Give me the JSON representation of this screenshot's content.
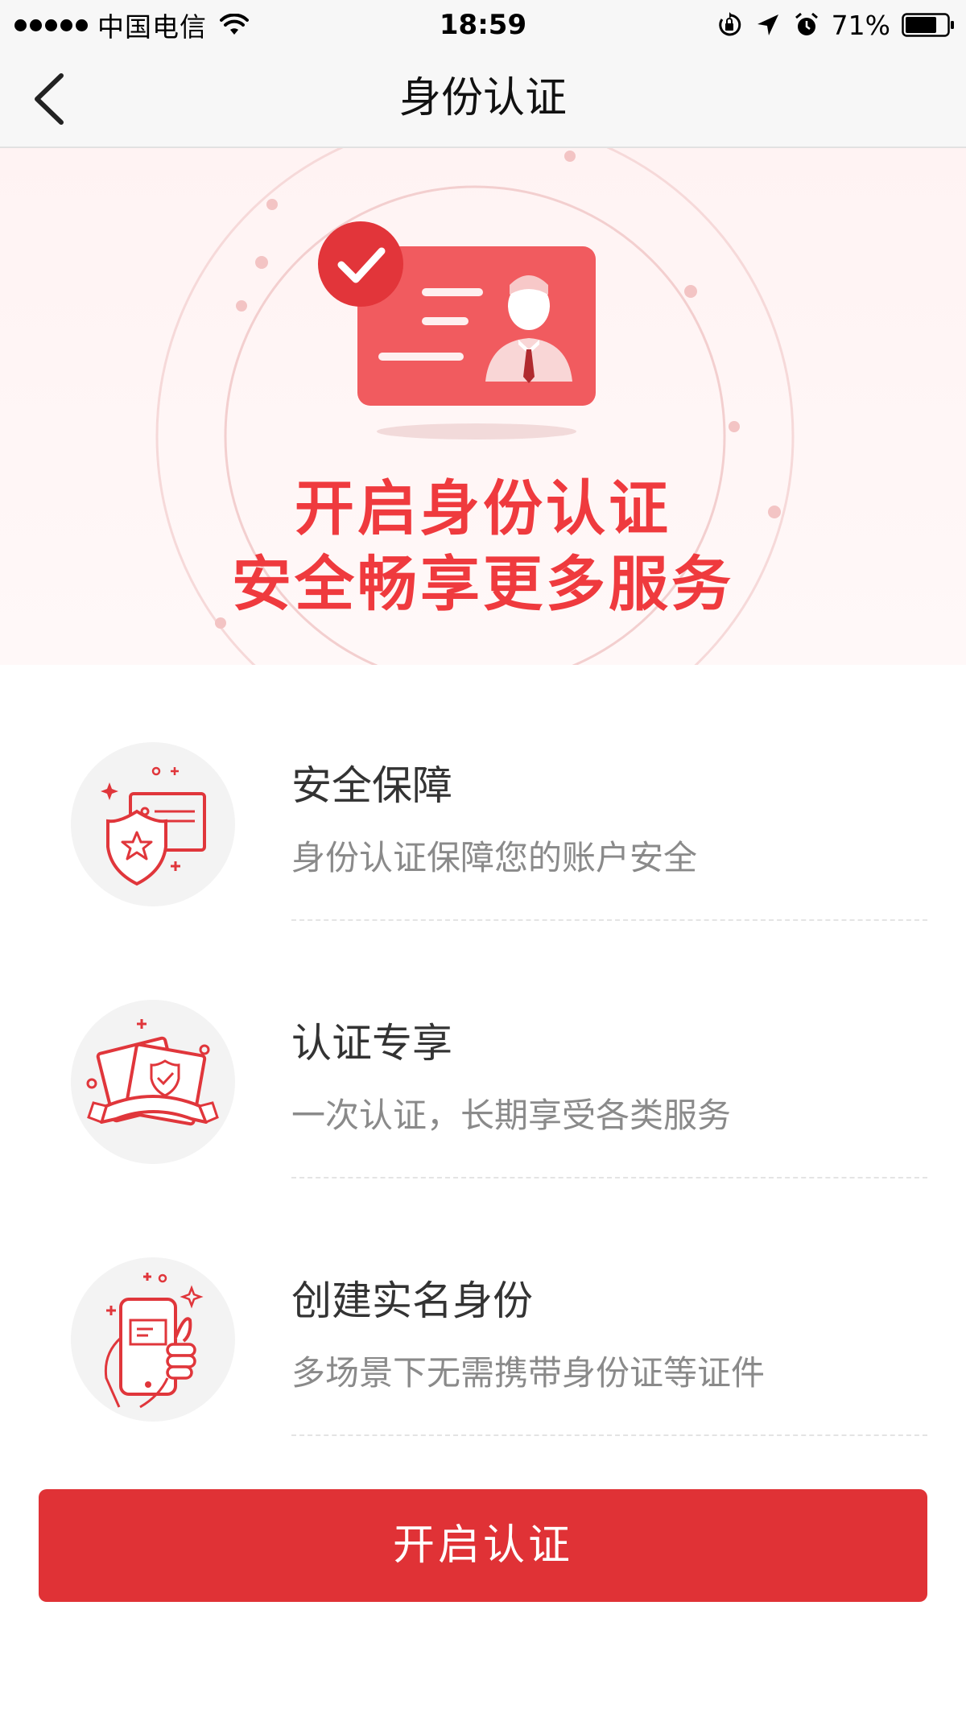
{
  "status_bar": {
    "carrier": "中国电信",
    "time": "18:59",
    "battery_percent": "71%",
    "icons": [
      "signal-dots-icon",
      "wifi-icon",
      "orientation-lock-icon",
      "location-arrow-icon",
      "alarm-icon",
      "battery-icon"
    ]
  },
  "nav": {
    "title": "身份认证",
    "back_icon": "chevron-left-icon"
  },
  "hero": {
    "line1": "开启身份认证",
    "line2": "安全畅享更多服务",
    "illustration": "id-card-verified-illustration",
    "accent_color": "#ef3a3e"
  },
  "features": [
    {
      "icon": "shield-star-icon",
      "title": "安全保障",
      "desc": "身份认证保障您的账户安全"
    },
    {
      "icon": "certificate-ribbon-icon",
      "title": "认证专享",
      "desc": "一次认证，长期享受各类服务"
    },
    {
      "icon": "phone-in-hand-icon",
      "title": "创建实名身份",
      "desc": "多场景下无需携带身份证等证件"
    }
  ],
  "cta": {
    "label": "开启认证",
    "color": "#e03236"
  }
}
